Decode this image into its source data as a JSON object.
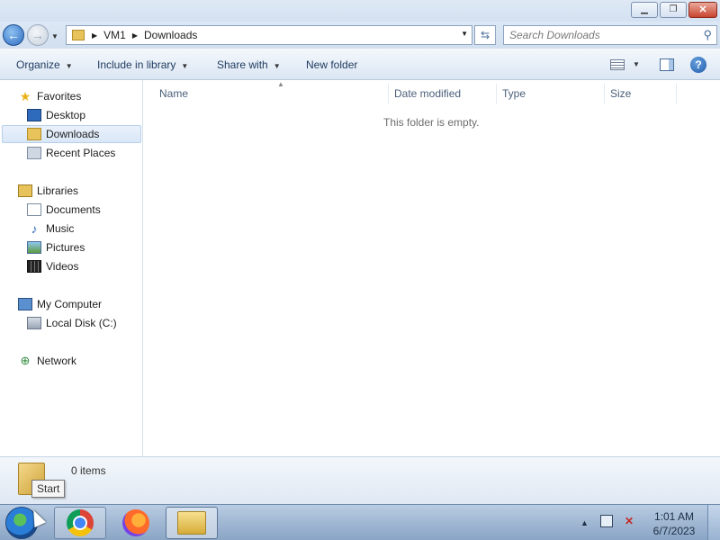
{
  "window": {
    "min_glyph": "▁",
    "max_glyph": "❐",
    "close_glyph": "✕"
  },
  "address": {
    "crumbs": [
      "VM1",
      "Downloads"
    ],
    "search_placeholder": "Search Downloads"
  },
  "toolbar": {
    "organize": "Organize",
    "include_in_library": "Include in library",
    "share_with": "Share with",
    "new_folder": "New folder",
    "help": "?"
  },
  "nav": {
    "favorites": "Favorites",
    "desktop": "Desktop",
    "downloads": "Downloads",
    "recent_places": "Recent Places",
    "libraries": "Libraries",
    "documents": "Documents",
    "music": "Music",
    "pictures": "Pictures",
    "videos": "Videos",
    "my_computer": "My Computer",
    "local_disk": "Local Disk (C:)",
    "network": "Network"
  },
  "columns": {
    "name": "Name",
    "date_modified": "Date modified",
    "type": "Type",
    "size": "Size"
  },
  "content": {
    "empty_message": "This folder is empty."
  },
  "details": {
    "items_count": "0 items"
  },
  "tooltip": {
    "start": "Start"
  },
  "taskbar": {
    "time": "1:01 AM",
    "date": "6/7/2023"
  },
  "colors": {
    "titlebar": "#dfe9f5",
    "toolbar_text": "#1e3a5f",
    "selected_nav": "#d9e7f7",
    "taskbar": "#8aa5c5"
  }
}
